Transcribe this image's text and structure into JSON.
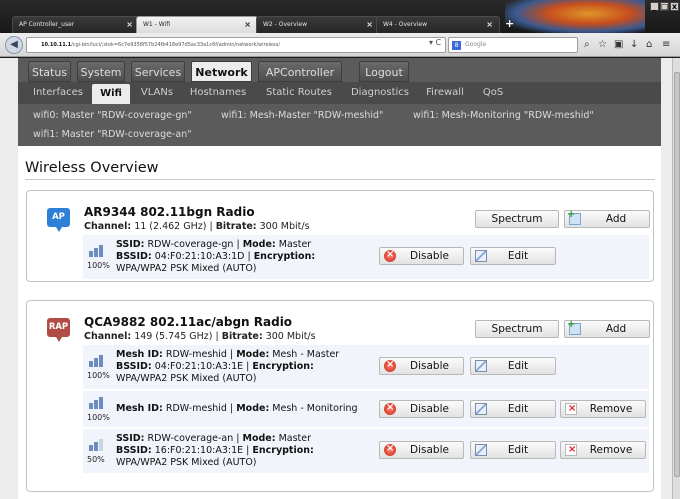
{
  "browser": {
    "tabs": [
      {
        "label": "AP Controller_user",
        "active": false
      },
      {
        "label": "W1 - Wifi",
        "active": true
      },
      {
        "label": "W2 - Overview",
        "active": false
      },
      {
        "label": "W4 - Overview",
        "active": false
      }
    ],
    "url_host": "10.10.11.1",
    "url_path": "/cgi-bin/luci/;stok=6c7e9358f57b24fb418e97d5ac33a1c6f/admin/network/wireless/",
    "search_placeholder": "Google"
  },
  "main_nav": [
    "Status",
    "System",
    "Services",
    "Network",
    "APController",
    "Logout"
  ],
  "main_nav_active": "Network",
  "sub_nav": [
    "Interfaces",
    "Wifi",
    "VLANs",
    "Hostnames",
    "Static Routes",
    "Diagnostics",
    "Firewall",
    "QoS"
  ],
  "sub_nav_active": "Wifi",
  "iface_links": [
    "wifi0: Master \"RDW-coverage-gn\"",
    "wifi1: Mesh-Master \"RDW-meshid\"",
    "wifi1: Mesh-Monitoring \"RDW-meshid\"",
    "wifi1: Master \"RDW-coverage-an\""
  ],
  "page_title": "Wireless Overview",
  "buttons": {
    "spectrum": "Spectrum",
    "add": "Add",
    "disable": "Disable",
    "edit": "Edit",
    "remove": "Remove"
  },
  "radios": [
    {
      "badge": "AP",
      "badge_color": "#2e7fd6",
      "title": "AR9344 802.11bgn Radio",
      "channel": "11 (2.462 GHz)",
      "bitrate": "300 Mbit/s",
      "networks": [
        {
          "signal": "100%",
          "name_label": "SSID:",
          "name": "RDW-coverage-gn",
          "mode": "Master",
          "bssid": "04:F0:21:10:A3:1D",
          "encryption": "WPA/WPA2 PSK Mixed (AUTO)"
        }
      ]
    },
    {
      "badge": "RAP",
      "badge_color": "#b24d45",
      "title": "QCA9882 802.11ac/abgn Radio",
      "channel": "149 (5.745 GHz)",
      "bitrate": "300 Mbit/s",
      "networks": [
        {
          "signal": "100%",
          "name_label": "Mesh ID:",
          "name": "RDW-meshid",
          "mode": "Mesh - Master",
          "bssid": "04:F0:21:10:A3:1E",
          "encryption": "WPA/WPA2 PSK Mixed (AUTO)"
        },
        {
          "signal": "100%",
          "name_label": "Mesh ID:",
          "name": "RDW-meshid",
          "mode": "Mesh - Monitoring"
        },
        {
          "signal": "50%",
          "name_label": "SSID:",
          "name": "RDW-coverage-an",
          "mode": "Master",
          "bssid": "16:F0:21:10:A3:1E",
          "encryption": "WPA/WPA2 PSK Mixed (AUTO)"
        }
      ]
    }
  ]
}
